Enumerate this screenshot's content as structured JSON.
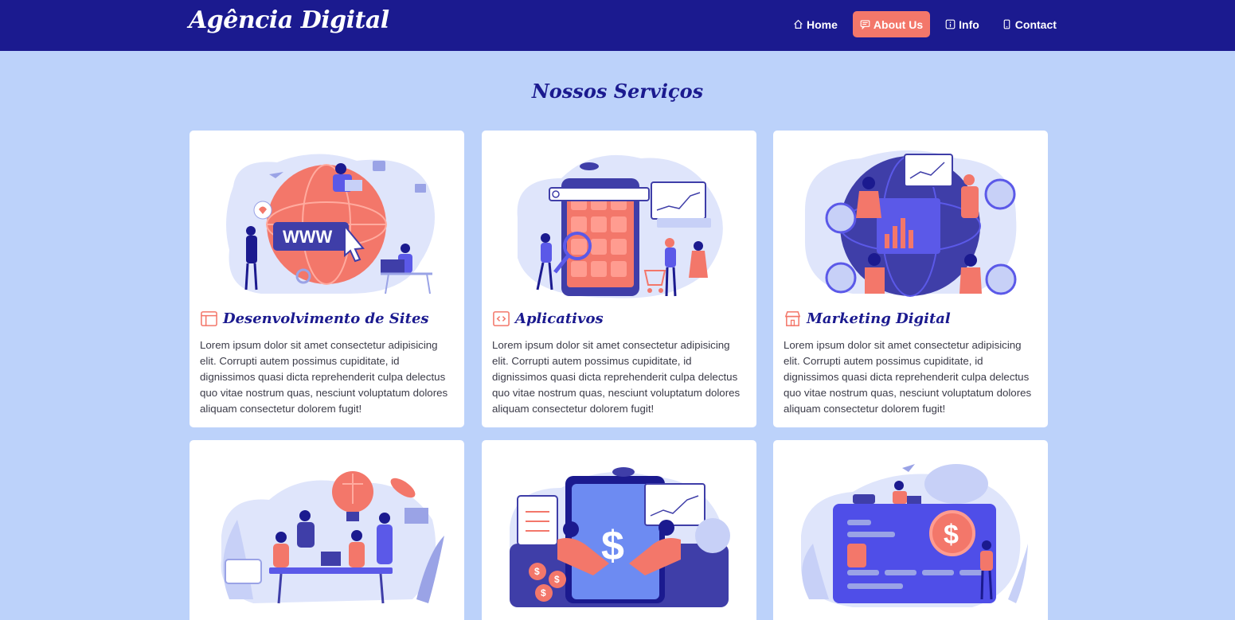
{
  "brand": "Agência Digital",
  "nav": [
    {
      "label": "Home",
      "icon": "home-icon"
    },
    {
      "label": "About Us",
      "icon": "chat-icon"
    },
    {
      "label": "Info",
      "icon": "info-icon"
    },
    {
      "label": "Contact",
      "icon": "phone-icon"
    }
  ],
  "section_title": "Nossos Serviços",
  "cards": [
    {
      "title": "Desenvolvimento de Sites",
      "icon": "browser-window-icon",
      "illustration": "website-globe-illustration",
      "text": "Lorem ipsum dolor sit amet consectetur adipisicing elit. Corrupti autem possimus cupiditate, id dignissimos quasi dicta reprehenderit culpa delectus quo vitae nostrum quas, nesciunt voluptatum dolores aliquam consectetur dolorem fugit!"
    },
    {
      "title": "Aplicativos",
      "icon": "code-icon",
      "illustration": "mobile-app-illustration",
      "text": "Lorem ipsum dolor sit amet consectetur adipisicing elit. Corrupti autem possimus cupiditate, id dignissimos quasi dicta reprehenderit culpa delectus quo vitae nostrum quas, nesciunt voluptatum dolores aliquam consectetur dolorem fugit!"
    },
    {
      "title": "Marketing Digital",
      "icon": "shop-icon",
      "illustration": "marketing-globe-illustration",
      "text": "Lorem ipsum dolor sit amet consectetur adipisicing elit. Corrupti autem possimus cupiditate, id dignissimos quasi dicta reprehenderit culpa delectus quo vitae nostrum quas, nesciunt voluptatum dolores aliquam consectetur dolorem fugit!"
    },
    {
      "illustration": "team-idea-illustration"
    },
    {
      "illustration": "handshake-dollar-illustration"
    },
    {
      "illustration": "credit-card-illustration"
    }
  ],
  "colors": {
    "navbar": "#1b1a8f",
    "accent": "#f3776a",
    "background": "#bcd2fa",
    "card": "#ffffff",
    "heading": "#1b1a8f"
  }
}
